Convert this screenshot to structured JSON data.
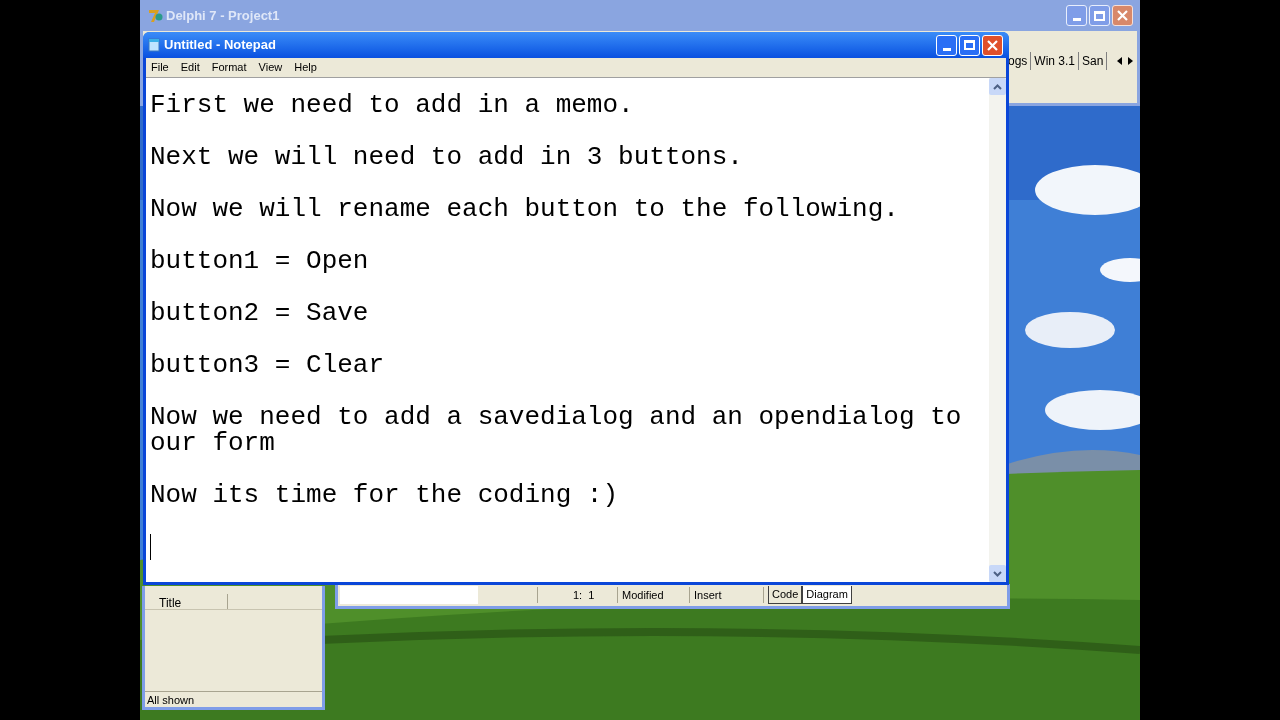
{
  "ide_window": {
    "title": "Delphi 7 - Project1",
    "palette_tabs": [
      "ogs",
      "Win 3.1",
      "San"
    ]
  },
  "notepad": {
    "title": "Untitled - Notepad",
    "menu": [
      "File",
      "Edit",
      "Format",
      "View",
      "Help"
    ],
    "paragraphs": [
      "First we need to add in a memo.",
      "Next we will need to add in 3 buttons.",
      "Now we will rename each button to the following.",
      "button1 = Open",
      "button2 = Save",
      "button3 = Clear",
      "Now we need to add a savedialog and an opendialog to our form",
      "Now its time for the coding :)"
    ]
  },
  "object_inspector": {
    "rows": [
      {
        "property": "Title"
      }
    ],
    "status": "All shown"
  },
  "code_editor": {
    "position": "1:  1",
    "modified": "Modified",
    "mode": "Insert",
    "tabs": [
      {
        "label": "Code",
        "selected": false
      },
      {
        "label": "Diagram",
        "selected": true
      }
    ]
  }
}
